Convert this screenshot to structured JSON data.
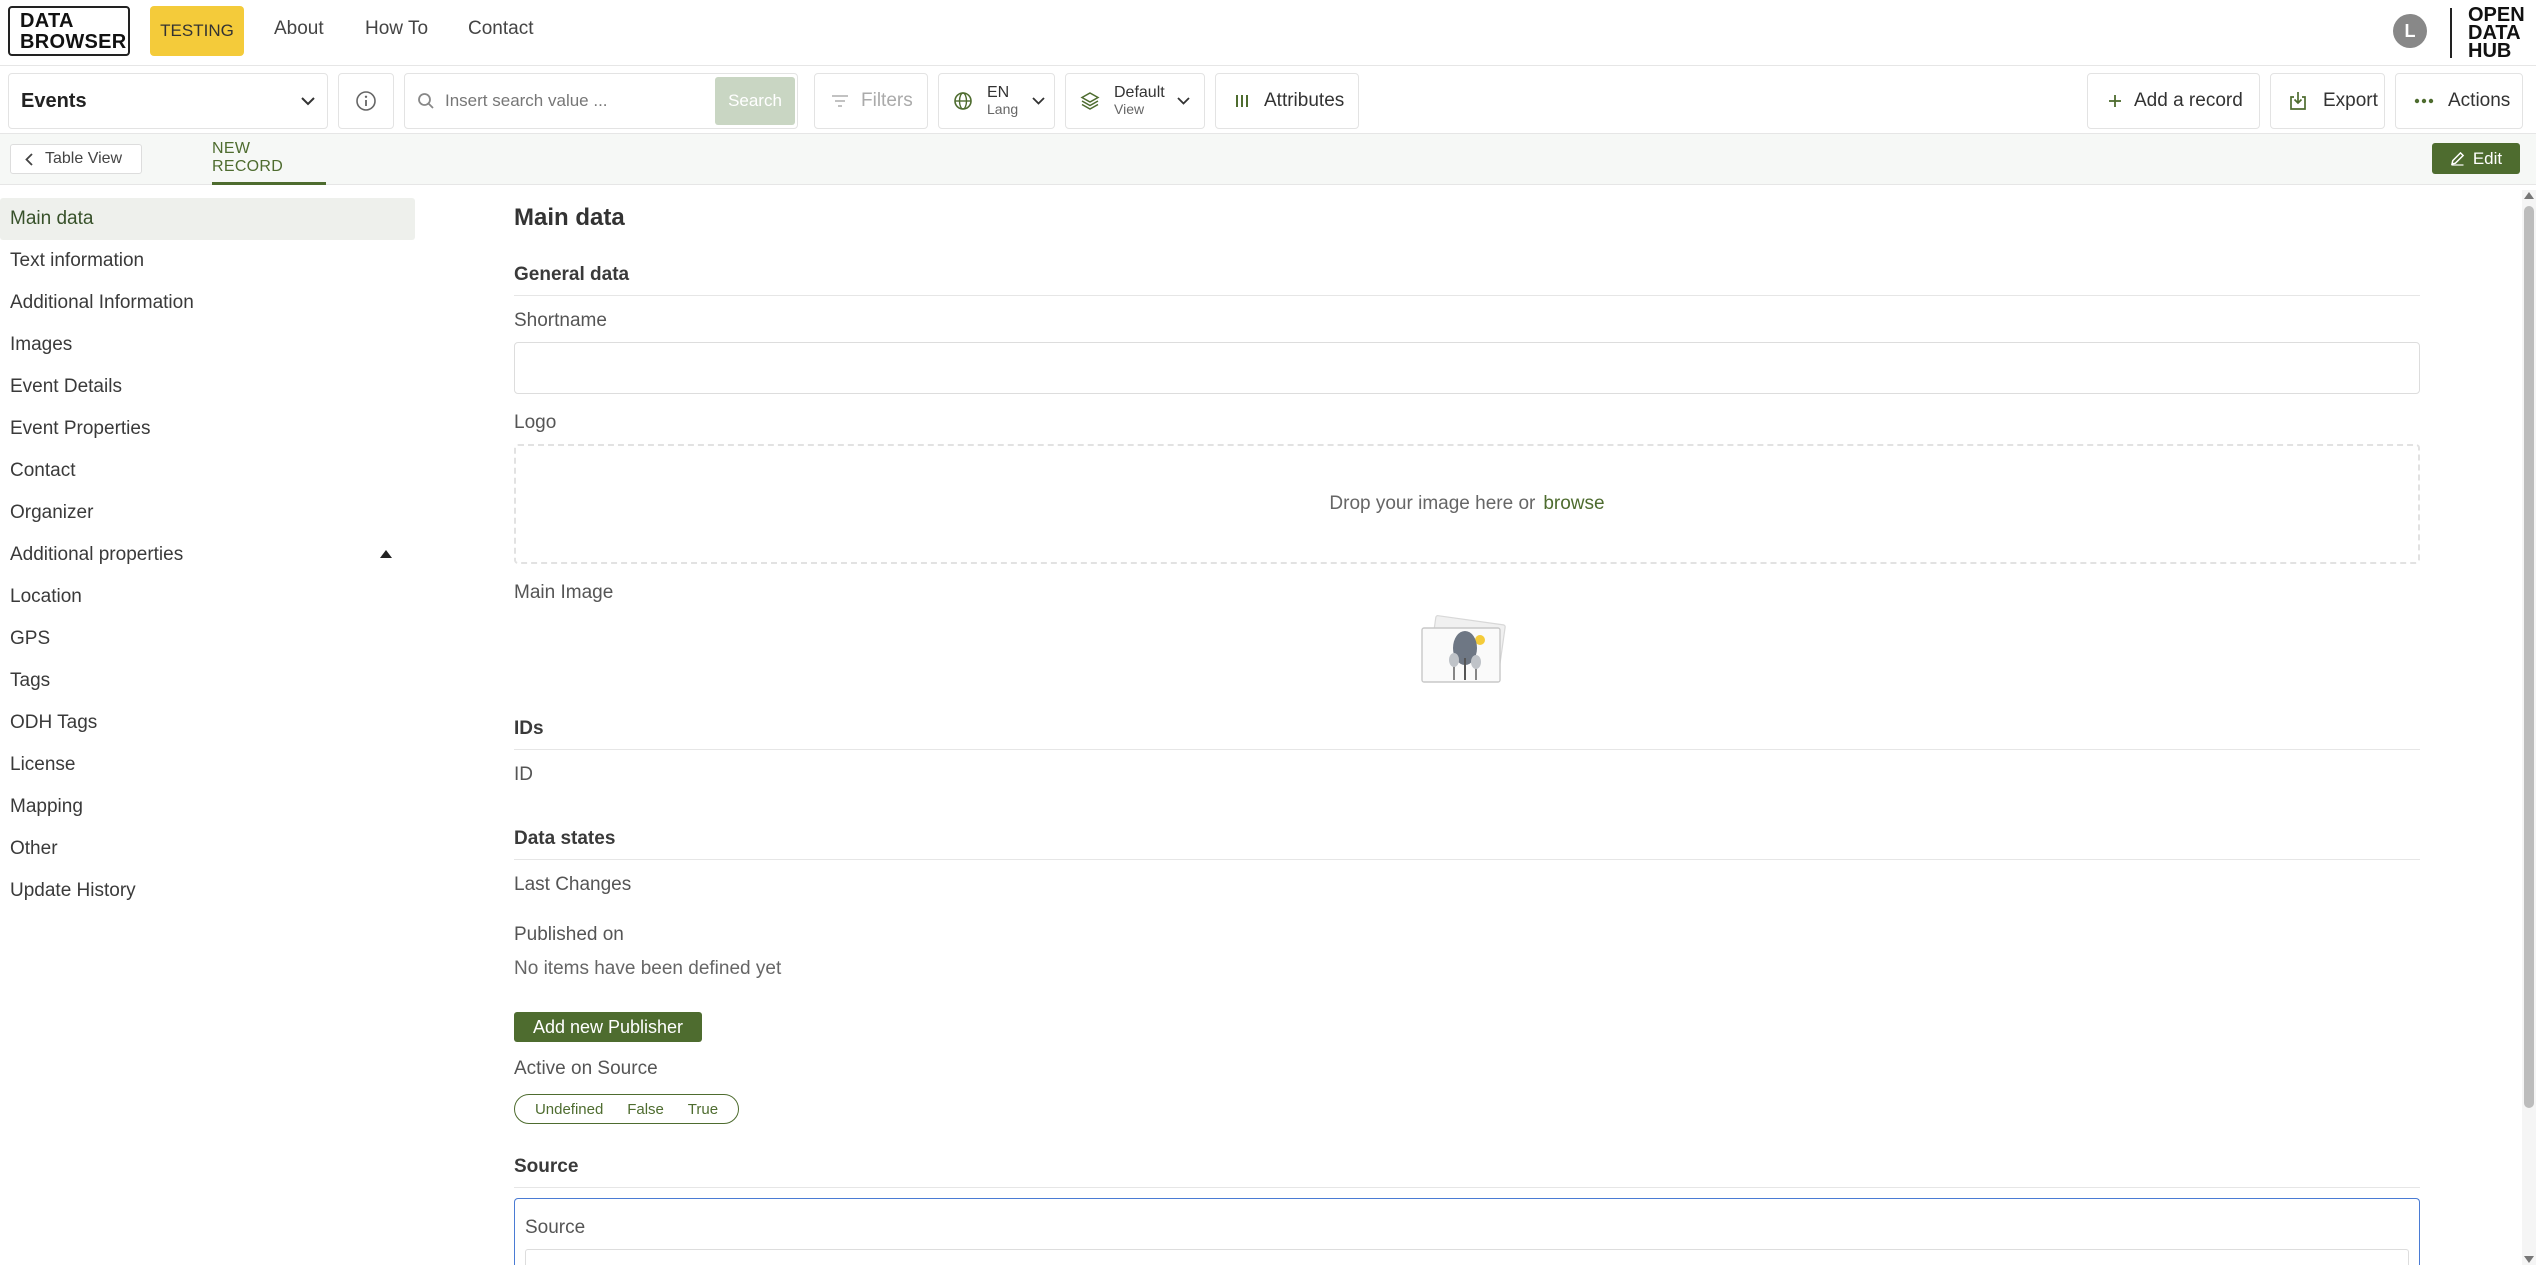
{
  "header": {
    "logo_line1": "DATA",
    "logo_line2": "BROWSER",
    "badge": "TESTING",
    "nav": [
      "About",
      "How To",
      "Contact"
    ],
    "avatar_letter": "L",
    "brand_line1": "OPEN",
    "brand_line2": "DATA",
    "brand_line3": "HUB"
  },
  "toolbar": {
    "dataset": "Events",
    "search_placeholder": "Insert search value ...",
    "search_button": "Search",
    "filters": "Filters",
    "lang_value": "EN",
    "lang_label": "Lang",
    "view_value": "Default",
    "view_label": "View",
    "attributes": "Attributes",
    "add_record": "Add a record",
    "export": "Export",
    "actions": "Actions"
  },
  "subbar": {
    "back": "Table View",
    "tab": "NEW RECORD",
    "edit": "Edit"
  },
  "sidebar": {
    "items": [
      {
        "label": "Main data"
      },
      {
        "label": "Text information"
      },
      {
        "label": "Additional Information"
      },
      {
        "label": "Images"
      },
      {
        "label": "Event Details"
      },
      {
        "label": "Event Properties"
      },
      {
        "label": "Contact"
      },
      {
        "label": "Organizer"
      },
      {
        "label": "Additional properties"
      },
      {
        "label": "Location"
      },
      {
        "label": "GPS"
      },
      {
        "label": "Tags"
      },
      {
        "label": "ODH Tags"
      },
      {
        "label": "License"
      },
      {
        "label": "Mapping"
      },
      {
        "label": "Other"
      },
      {
        "label": "Update History"
      }
    ]
  },
  "main": {
    "title": "Main data",
    "general_section": "General data",
    "shortname_label": "Shortname",
    "shortname_value": "",
    "logo_label": "Logo",
    "drop_text": "Drop your image here or",
    "browse": "browse",
    "main_image_label": "Main Image",
    "ids_section": "IDs",
    "id_label": "ID",
    "states_section": "Data states",
    "last_changes_label": "Last Changes",
    "published_on_label": "Published on",
    "no_items": "No items have been defined yet",
    "add_publisher": "Add new Publisher",
    "active_on_source_label": "Active on Source",
    "tri_options": [
      "Undefined",
      "False",
      "True"
    ],
    "source_section": "Source",
    "source_field_label": "Source"
  },
  "colors": {
    "accent_green": "#4e6c2f",
    "testing_yellow": "#f4cb3a",
    "focus_blue": "#4a7bd4"
  }
}
